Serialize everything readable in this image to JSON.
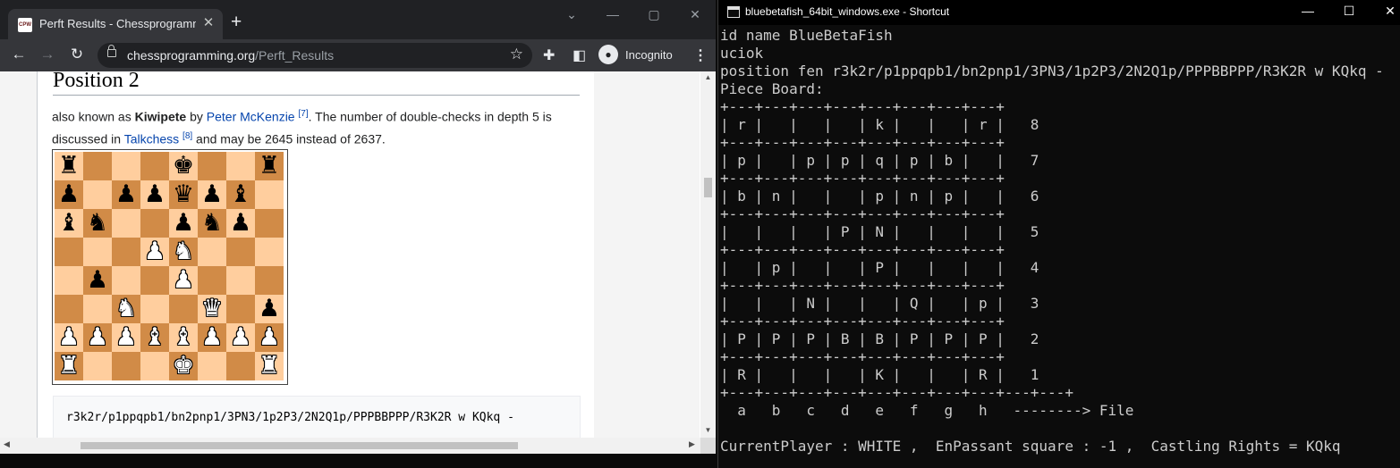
{
  "browser": {
    "tab_title": "Perft Results - Chessprogramming",
    "favicon_text": "CPW",
    "new_tab": "+",
    "url_domain": "chessprogramming.org",
    "url_path": "/Perft_Results",
    "incognito_label": "Incognito"
  },
  "page": {
    "heading": "Position 2",
    "para": {
      "t1": "also known as ",
      "bold": "Kiwipete",
      "t2": " by ",
      "link1": "Peter McKenzie",
      "sup1": "[7]",
      "t3": ". The number of double-checks in depth 5 is discussed in ",
      "link2": "Talkchess",
      "sup2": "[8]",
      "t4": " and may be 2645 instead of 2637."
    },
    "fen": "r3k2r/p1ppqpb1/bn2pnp1/3PN3/1p2P3/2N2Q1p/PPPBBPPP/R3K2R w KQkq -"
  },
  "board": {
    "ranks": [
      "r...k..r",
      "p.ppqpb.",
      "bn..pnp.",
      "...PN...",
      ".p..P...",
      "..N..Q.p",
      "PPPBBPPP",
      "R...K..R"
    ]
  },
  "console": {
    "title": "bluebetafish_64bit_windows.exe - Shortcut",
    "lines": [
      "id name BlueBetaFish",
      "uciok",
      "position fen r3k2r/p1ppqpb1/bn2pnp1/3PN3/1p2P3/2N2Q1p/PPPBBPPP/R3K2R w KQkq -",
      "Piece Board:",
      "+---+---+---+---+---+---+---+---+",
      "| r |   |   |   | k |   |   | r |   8",
      "+---+---+---+---+---+---+---+---+",
      "| p |   | p | p | q | p | b |   |   7",
      "+---+---+---+---+---+---+---+---+",
      "| b | n |   |   | p | n | p |   |   6",
      "+---+---+---+---+---+---+---+---+",
      "|   |   |   | P | N |   |   |   |   5",
      "+---+---+---+---+---+---+---+---+",
      "|   | p |   |   | P |   |   |   |   4",
      "+---+---+---+---+---+---+---+---+",
      "|   |   | N |   |   | Q |   | p |   3",
      "+---+---+---+---+---+---+---+---+",
      "| P | P | P | B | B | P | P | P |   2",
      "+---+---+---+---+---+---+---+---+",
      "| R |   |   |   | K |   |   | R |   1",
      "+---+---+---+---+---+---+---+---+---+---+",
      "  a   b   c   d   e   f   g   h   --------> File",
      "",
      "CurrentPlayer : WHITE ,  EnPassant square : -1 ,  Castling Rights = KQkq"
    ]
  }
}
